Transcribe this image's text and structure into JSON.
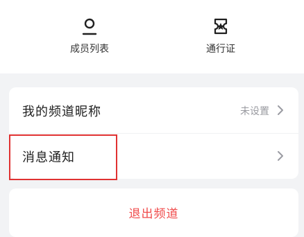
{
  "shortcuts": {
    "members": {
      "label": "成员列表",
      "icon": "person-icon"
    },
    "pass": {
      "label": "通行证",
      "icon": "ticket-icon"
    }
  },
  "settings": {
    "nickname": {
      "label": "我的频道昵称",
      "value": "未设置"
    },
    "notifications": {
      "label": "消息通知"
    }
  },
  "actions": {
    "leave_label": "退出频道"
  },
  "colors": {
    "danger": "#f04b4b",
    "highlight_border": "#e03131",
    "background": "#f2f3f5"
  }
}
